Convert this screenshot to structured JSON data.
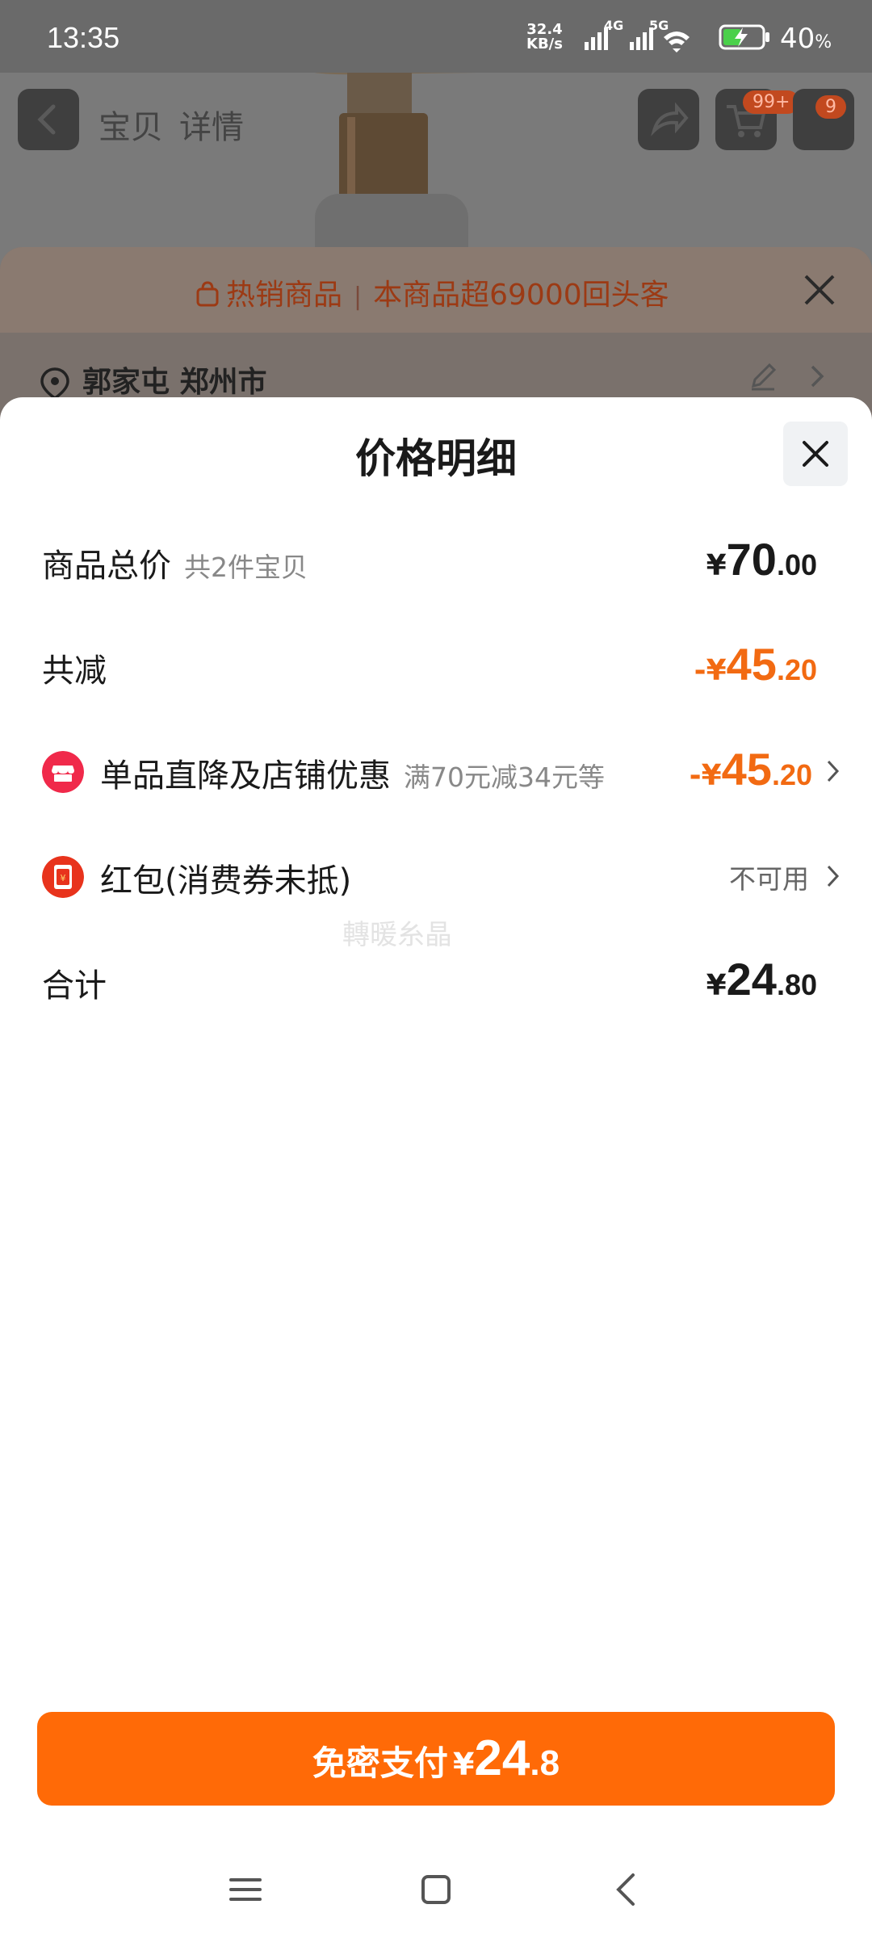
{
  "status_bar": {
    "time": "13:35",
    "net_speed_value": "32.4",
    "net_speed_unit": "KB/s",
    "net_4g": "4G",
    "net_5g": "5G",
    "battery": "40",
    "battery_unit": "%"
  },
  "background_page": {
    "tabs": [
      "宝贝",
      "详情"
    ],
    "cart_badge": "99+",
    "more_badge": "9",
    "hot_banner": {
      "tag": "热销商品",
      "message": "本商品超69000回头客"
    },
    "address": "郭家屯 郑州市"
  },
  "price_detail": {
    "title": "价格明细",
    "rows": {
      "subtotal": {
        "label": "商品总价",
        "sub": "共2件宝贝",
        "symbol": "¥",
        "int": "70",
        "dec": ".00"
      },
      "total_discount": {
        "label": "共减",
        "symbol": "-¥",
        "int": "45",
        "dec": ".20"
      },
      "shop_discount": {
        "label": "单品直降及店铺优惠",
        "sub": "满70元减34元等",
        "symbol": "-¥",
        "int": "45",
        "dec": ".20"
      },
      "red_packet": {
        "label": "红包(消费券未抵)",
        "status": "不可用"
      },
      "total": {
        "label": "合计",
        "symbol": "¥",
        "int": "24",
        "dec": ".80"
      }
    },
    "watermark": "轉暖糸晶"
  },
  "pay_button": {
    "label": "免密支付",
    "symbol": "¥",
    "int": "24",
    "dec": ".8"
  },
  "colors": {
    "accent": "#ff6a07",
    "discount": "#f26a12",
    "shop_icon": "#f0294a",
    "red_packet_icon": "#e8331c"
  }
}
